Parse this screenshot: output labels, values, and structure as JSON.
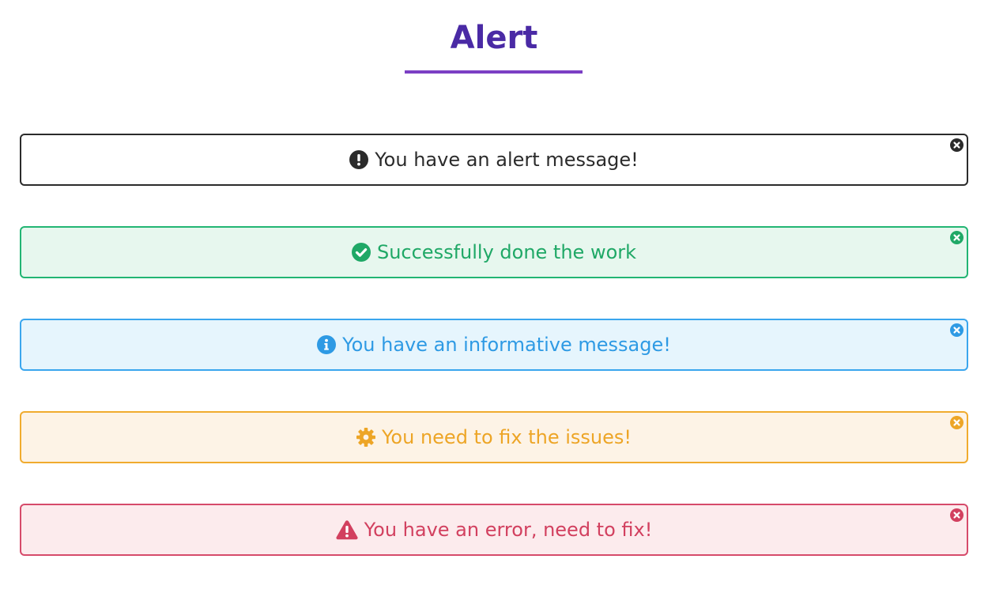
{
  "page": {
    "title": "Alert"
  },
  "alerts": [
    {
      "type": "default",
      "icon": "exclamation-circle-icon",
      "message": "You have an alert message!",
      "color": "#2b2b2b"
    },
    {
      "type": "success",
      "icon": "check-circle-icon",
      "message": "Successfully done the work",
      "color": "#1fa866"
    },
    {
      "type": "info",
      "icon": "info-circle-icon",
      "message": "You have an informative message!",
      "color": "#2e9ae4"
    },
    {
      "type": "warning",
      "icon": "gear-icon",
      "message": "You need to fix the issues!",
      "color": "#eda526"
    },
    {
      "type": "danger",
      "icon": "warning-triangle-icon",
      "message": "You have an error, need to fix!",
      "color": "#d2405f"
    }
  ],
  "colors": {
    "title": "#4a2aa5",
    "underline": "#7b3fc4"
  }
}
